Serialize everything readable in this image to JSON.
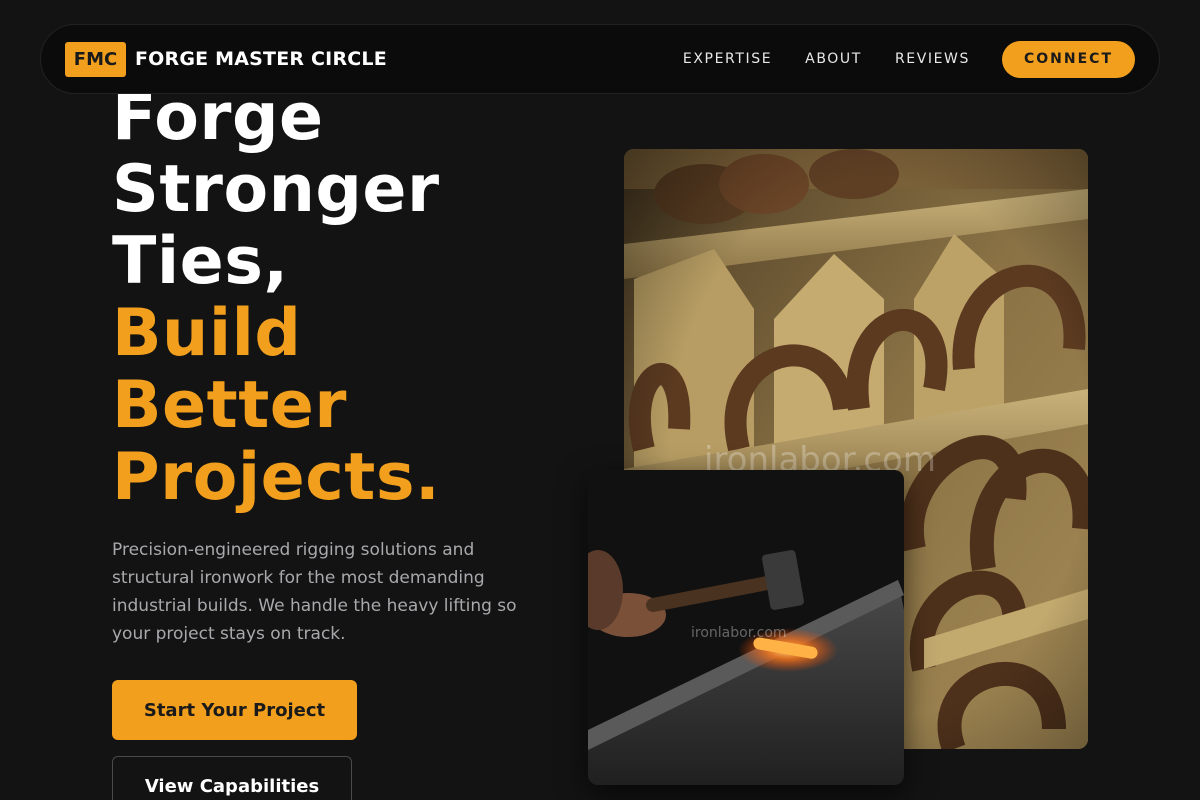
{
  "nav": {
    "logo_badge": "FMC",
    "brand": "FORGE MASTER CIRCLE",
    "links": [
      "EXPERTISE",
      "ABOUT",
      "REVIEWS"
    ],
    "cta": "CONNECT"
  },
  "hero": {
    "headline_lines": [
      "Forge",
      "Stronger",
      "Ties,"
    ],
    "accent_lines": [
      "Build",
      "Better",
      "Projects."
    ],
    "description": "Precision-engineered rigging solutions and structural ironwork for the most demanding industrial builds. We handle the heavy lifting so your project stays on track.",
    "primary_button": "Start Your Project",
    "secondary_button": "View Capabilities"
  },
  "images": {
    "main_watermark": "ironlabor.com",
    "small_watermark": "ironlabor.com"
  },
  "colors": {
    "accent": "#f29f1d",
    "background": "#131313",
    "nav_background": "#0b0b0b",
    "body_text": "#a9a9ad"
  }
}
